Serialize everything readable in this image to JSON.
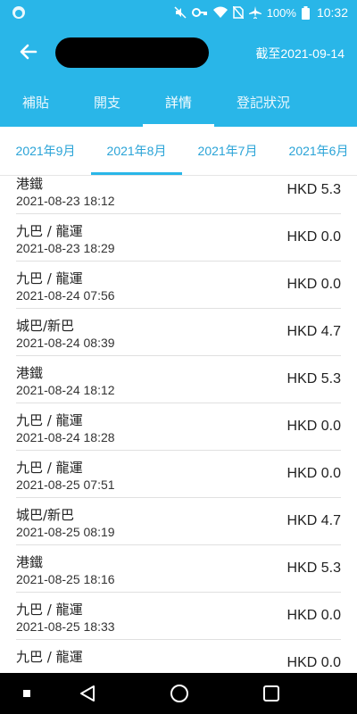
{
  "status_bar": {
    "battery_percent": "100%",
    "time": "10:32",
    "icons": [
      "mute-icon",
      "key-icon",
      "wifi-icon",
      "no-sim-icon",
      "airplane-icon",
      "battery-icon"
    ]
  },
  "header": {
    "as_of": "截至2021-09-14"
  },
  "tabs": [
    {
      "label": "補貼"
    },
    {
      "label": "開支"
    },
    {
      "label": "詳情",
      "active": true
    },
    {
      "label": "登記狀況"
    }
  ],
  "months": [
    {
      "label": "2021年9月"
    },
    {
      "label": "2021年8月",
      "active": true
    },
    {
      "label": "2021年7月"
    },
    {
      "label": "2021年6月"
    }
  ],
  "trips": [
    {
      "operator": "港鐵",
      "time": "2021-08-23 18:12",
      "amount": "HKD 5.3"
    },
    {
      "operator": "九巴 / 龍運",
      "time": "2021-08-23 18:29",
      "amount": "HKD 0.0"
    },
    {
      "operator": "九巴 / 龍運",
      "time": "2021-08-24 07:56",
      "amount": "HKD 0.0"
    },
    {
      "operator": "城巴/新巴",
      "time": "2021-08-24 08:39",
      "amount": "HKD 4.7"
    },
    {
      "operator": "港鐵",
      "time": "2021-08-24 18:12",
      "amount": "HKD 5.3"
    },
    {
      "operator": "九巴 / 龍運",
      "time": "2021-08-24 18:28",
      "amount": "HKD 0.0"
    },
    {
      "operator": "九巴 / 龍運",
      "time": "2021-08-25 07:51",
      "amount": "HKD 0.0"
    },
    {
      "operator": "城巴/新巴",
      "time": "2021-08-25 08:19",
      "amount": "HKD 4.7"
    },
    {
      "operator": "港鐵",
      "time": "2021-08-25 18:16",
      "amount": "HKD 5.3"
    },
    {
      "operator": "九巴 / 龍運",
      "time": "2021-08-25 18:33",
      "amount": "HKD 0.0"
    },
    {
      "operator": "九巴 / 龍運",
      "time": "",
      "amount": "HKD 0.0"
    }
  ],
  "colors": {
    "primary": "#29b6e8",
    "month_text": "#29a3d7",
    "nav_bar": "#000000"
  }
}
